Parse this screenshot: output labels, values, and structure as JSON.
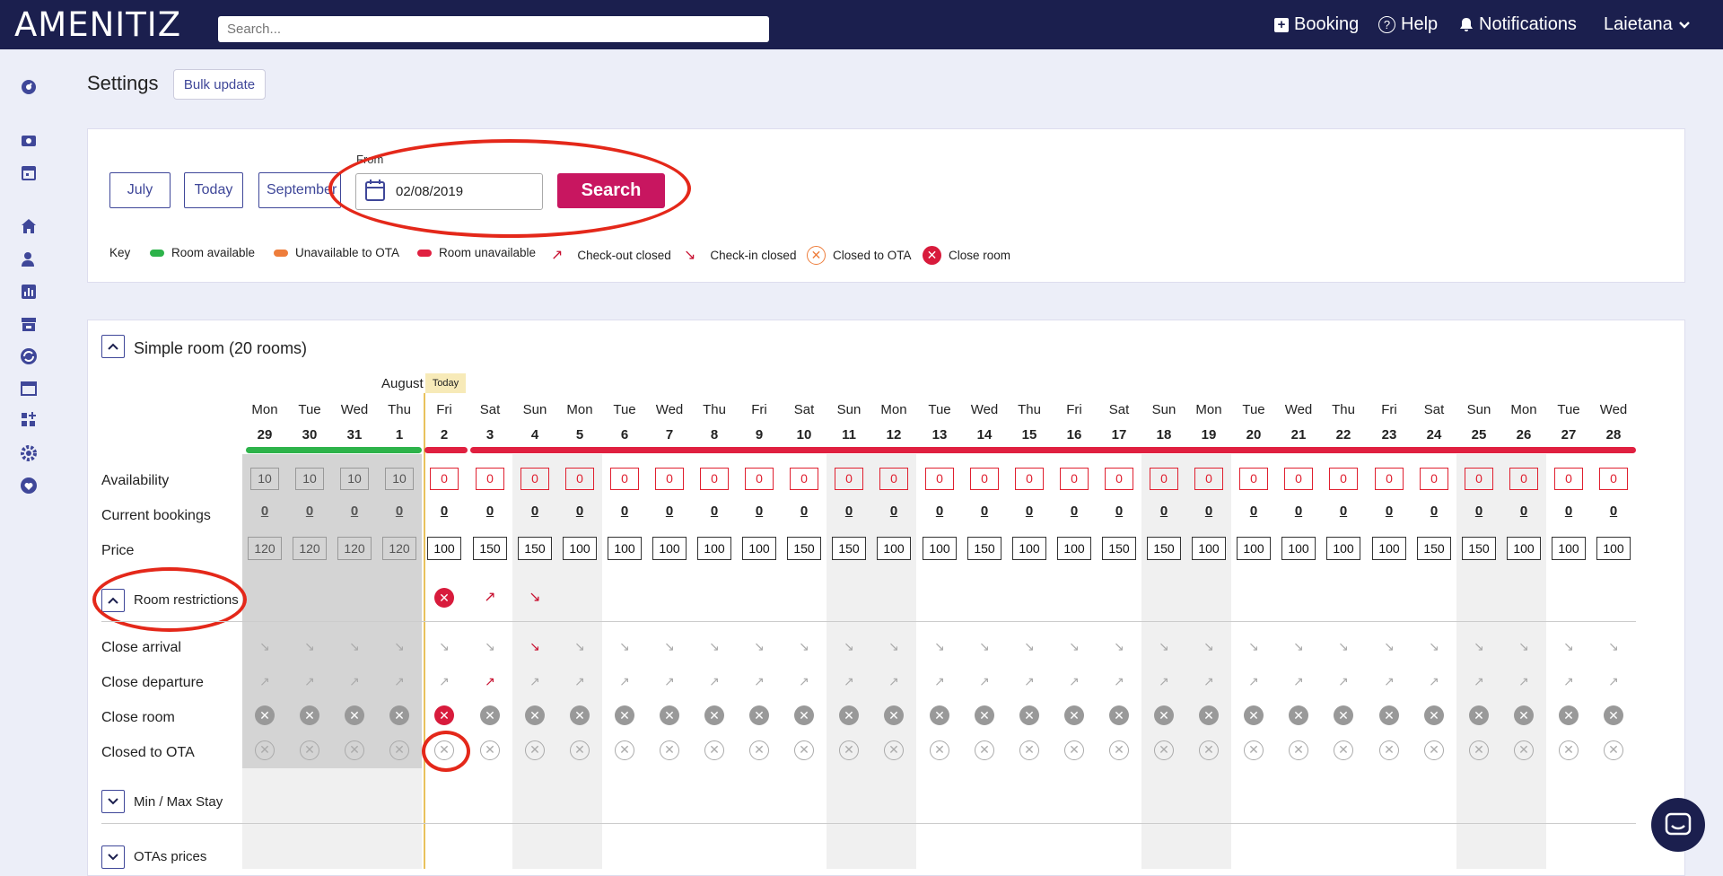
{
  "topbar": {
    "logo": "AMENITIZ",
    "search_placeholder": "Search...",
    "booking": "Booking",
    "help": "Help",
    "notifications": "Notifications",
    "user": "Laietana"
  },
  "sidebar": {
    "icons": [
      "dashboard-icon",
      "camera-icon",
      "calendar-icon",
      "home-icon",
      "users-icon",
      "chart-icon",
      "store-icon",
      "sync-icon",
      "browser-icon",
      "apps-add-icon",
      "gear-icon",
      "heart-icon"
    ]
  },
  "page": {
    "title": "Settings",
    "bulk_update": "Bulk update"
  },
  "filters": {
    "prev_month": "July",
    "today": "Today",
    "next_month": "September",
    "from_label": "From",
    "from_value": "02/08/2019",
    "search": "Search"
  },
  "key": {
    "label": "Key",
    "room_available": "Room available",
    "unavailable_ota": "Unavailable to OTA",
    "room_unavailable": "Room unavailable",
    "checkout_closed": "Check-out closed",
    "checkin_closed": "Check-in closed",
    "closed_ota": "Closed to OTA",
    "close_room": "Close room",
    "colors": {
      "available": "#2db34a",
      "unavailable_ota": "#ee7d3b",
      "unavailable": "#e02040"
    }
  },
  "calendar": {
    "room_title": "Simple room (20 rooms)",
    "month": "August",
    "today_badge": "Today",
    "days": [
      {
        "dow": "Mon",
        "num": "29",
        "avail": "10",
        "book": "0",
        "price": "120",
        "past": true,
        "weekend": false
      },
      {
        "dow": "Tue",
        "num": "30",
        "avail": "10",
        "book": "0",
        "price": "120",
        "past": true,
        "weekend": false
      },
      {
        "dow": "Wed",
        "num": "31",
        "avail": "10",
        "book": "0",
        "price": "120",
        "past": true,
        "weekend": false
      },
      {
        "dow": "Thu",
        "num": "1",
        "avail": "10",
        "book": "0",
        "price": "120",
        "past": true,
        "weekend": false
      },
      {
        "dow": "Fri",
        "num": "2",
        "avail": "0",
        "book": "0",
        "price": "100",
        "past": false,
        "weekend": false
      },
      {
        "dow": "Sat",
        "num": "3",
        "avail": "0",
        "book": "0",
        "price": "150",
        "past": false,
        "weekend": false
      },
      {
        "dow": "Sun",
        "num": "4",
        "avail": "0",
        "book": "0",
        "price": "150",
        "past": false,
        "weekend": true
      },
      {
        "dow": "Mon",
        "num": "5",
        "avail": "0",
        "book": "0",
        "price": "100",
        "past": false,
        "weekend": true
      },
      {
        "dow": "Tue",
        "num": "6",
        "avail": "0",
        "book": "0",
        "price": "100",
        "past": false,
        "weekend": false
      },
      {
        "dow": "Wed",
        "num": "7",
        "avail": "0",
        "book": "0",
        "price": "100",
        "past": false,
        "weekend": false
      },
      {
        "dow": "Thu",
        "num": "8",
        "avail": "0",
        "book": "0",
        "price": "100",
        "past": false,
        "weekend": false
      },
      {
        "dow": "Fri",
        "num": "9",
        "avail": "0",
        "book": "0",
        "price": "100",
        "past": false,
        "weekend": false
      },
      {
        "dow": "Sat",
        "num": "10",
        "avail": "0",
        "book": "0",
        "price": "150",
        "past": false,
        "weekend": false
      },
      {
        "dow": "Sun",
        "num": "11",
        "avail": "0",
        "book": "0",
        "price": "150",
        "past": false,
        "weekend": true
      },
      {
        "dow": "Mon",
        "num": "12",
        "avail": "0",
        "book": "0",
        "price": "100",
        "past": false,
        "weekend": true
      },
      {
        "dow": "Tue",
        "num": "13",
        "avail": "0",
        "book": "0",
        "price": "100",
        "past": false,
        "weekend": false
      },
      {
        "dow": "Wed",
        "num": "14",
        "avail": "0",
        "book": "0",
        "price": "150",
        "past": false,
        "weekend": false
      },
      {
        "dow": "Thu",
        "num": "15",
        "avail": "0",
        "book": "0",
        "price": "100",
        "past": false,
        "weekend": false
      },
      {
        "dow": "Fri",
        "num": "16",
        "avail": "0",
        "book": "0",
        "price": "100",
        "past": false,
        "weekend": false
      },
      {
        "dow": "Sat",
        "num": "17",
        "avail": "0",
        "book": "0",
        "price": "150",
        "past": false,
        "weekend": false
      },
      {
        "dow": "Sun",
        "num": "18",
        "avail": "0",
        "book": "0",
        "price": "150",
        "past": false,
        "weekend": true
      },
      {
        "dow": "Mon",
        "num": "19",
        "avail": "0",
        "book": "0",
        "price": "100",
        "past": false,
        "weekend": true
      },
      {
        "dow": "Tue",
        "num": "20",
        "avail": "0",
        "book": "0",
        "price": "100",
        "past": false,
        "weekend": false
      },
      {
        "dow": "Wed",
        "num": "21",
        "avail": "0",
        "book": "0",
        "price": "100",
        "past": false,
        "weekend": false
      },
      {
        "dow": "Thu",
        "num": "22",
        "avail": "0",
        "book": "0",
        "price": "100",
        "past": false,
        "weekend": false
      },
      {
        "dow": "Fri",
        "num": "23",
        "avail": "0",
        "book": "0",
        "price": "100",
        "past": false,
        "weekend": false
      },
      {
        "dow": "Sat",
        "num": "24",
        "avail": "0",
        "book": "0",
        "price": "150",
        "past": false,
        "weekend": false
      },
      {
        "dow": "Sun",
        "num": "25",
        "avail": "0",
        "book": "0",
        "price": "150",
        "past": false,
        "weekend": true
      },
      {
        "dow": "Mon",
        "num": "26",
        "avail": "0",
        "book": "0",
        "price": "100",
        "past": false,
        "weekend": true
      },
      {
        "dow": "Tue",
        "num": "27",
        "avail": "0",
        "book": "0",
        "price": "100",
        "past": false,
        "weekend": false
      },
      {
        "dow": "Wed",
        "num": "28",
        "avail": "0",
        "book": "0",
        "price": "100",
        "past": false,
        "weekend": false
      }
    ],
    "rows": {
      "availability": "Availability",
      "current_bookings": "Current bookings",
      "price": "Price",
      "room_restrictions": "Room restrictions",
      "close_arrival": "Close arrival",
      "close_departure": "Close departure",
      "close_room": "Close room",
      "closed_to_ota": "Closed to OTA",
      "min_max_stay": "Min / Max Stay",
      "otas_prices": "OTAs prices"
    },
    "restriction_summary": {
      "close_room_day": "2",
      "checkout_closed_day": "3",
      "checkin_closed_day": "4"
    },
    "close_arrival_red_day": "4",
    "close_departure_red_day": "3",
    "close_room_red_day": "2"
  }
}
